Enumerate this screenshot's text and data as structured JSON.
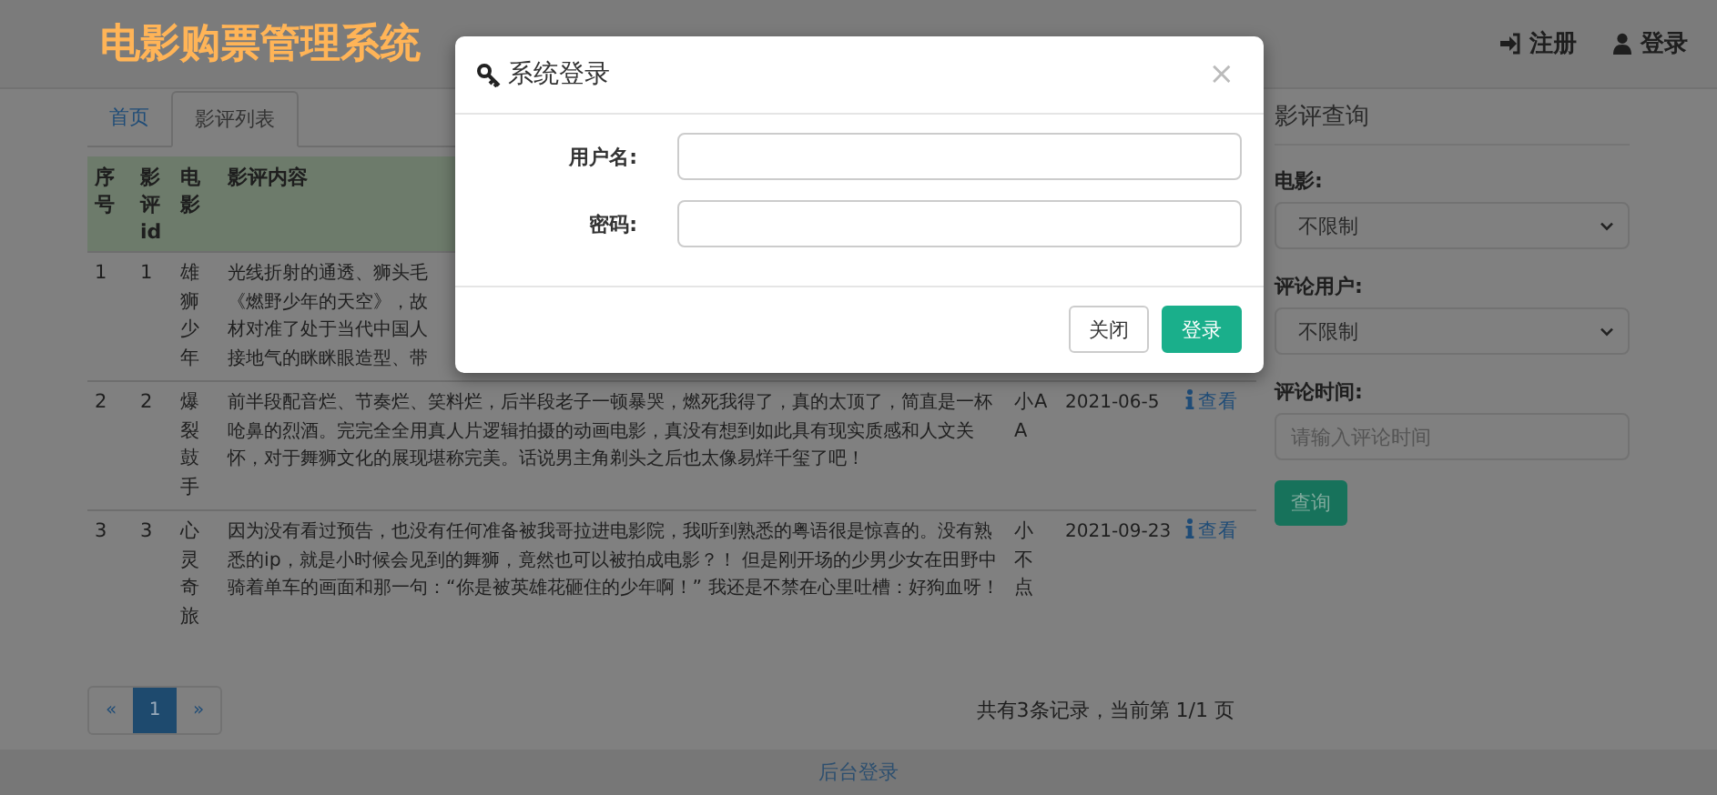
{
  "brand": "电影购票管理系统",
  "header_actions": [
    {
      "label": "注册"
    },
    {
      "label": "登录"
    }
  ],
  "tabs": [
    {
      "label": "首页",
      "selected": false
    },
    {
      "label": "影评列表",
      "selected": true
    }
  ],
  "table": {
    "columns": [
      "序号",
      "影评id",
      "电影",
      "影评内容"
    ],
    "rows": [
      {
        "id": "1",
        "review_id": "1",
        "movie": "雄狮少年",
        "content": [
          "光线折射的通透、狮头毛",
          "《燃野少年的天空》，故",
          "材对准了处于当代中国人",
          "接地气的眯眯眼造型、带"
        ]
      },
      {
        "id": "2",
        "review_id": "2",
        "movie": "爆裂鼓手",
        "content": "前半段配音烂、节奏烂、笑料烂，后半段老子一顿暴哭，燃死我得了，真的太顶了，简直是一杯呛鼻的烈酒。完完全全用真人片逻辑拍摄的动画电影，真没有想到如此具有现实质感和人文关怀，对于舞狮文化的展现堪称完美。话说男主角剃头之后也太像易烊千玺了吧！",
        "user": "小AA",
        "time": "2021-06-5",
        "action": "查看"
      },
      {
        "id": "3",
        "review_id": "3",
        "movie": "心灵奇旅",
        "content": "因为没有看过预告，也没有任何准备被我哥拉进电影院，我听到熟悉的粤语很是惊喜的。没有熟悉的ip，就是小时候会见到的舞狮，竟然也可以被拍成电影？！ 但是刚开场的少男少女在田野中骑着单车的画面和那一句：“你是被英雄花砸住的少年啊！” 我还是不禁在心里吐槽：好狗血呀！",
        "user": "小不点",
        "time": "2021-09-23",
        "action": "查看"
      }
    ]
  },
  "pagination": {
    "pages": [
      {
        "label": "«",
        "selected": false
      },
      {
        "label": "1",
        "selected": true
      },
      {
        "label": "»",
        "selected": false
      }
    ],
    "summary": "共有3条记录，当前第 1/1 页"
  },
  "sidebar": {
    "title": "影评查询",
    "filters": [
      {
        "label": "电影:",
        "kind": "select",
        "value": "不限制"
      },
      {
        "label": "评论用户:",
        "kind": "select",
        "value": "不限制"
      },
      {
        "label": "评论时间:",
        "kind": "input",
        "placeholder": "请输入评论时间"
      }
    ],
    "submit": "查询"
  },
  "footer": {
    "link": "后台登录"
  },
  "modal": {
    "title": "系统登录",
    "close": "×",
    "fields": [
      {
        "label": "用户名:"
      },
      {
        "label": "密码:"
      }
    ],
    "buttons": [
      {
        "label": "关闭",
        "kind": "default"
      },
      {
        "label": "登录",
        "kind": "primary"
      }
    ]
  }
}
